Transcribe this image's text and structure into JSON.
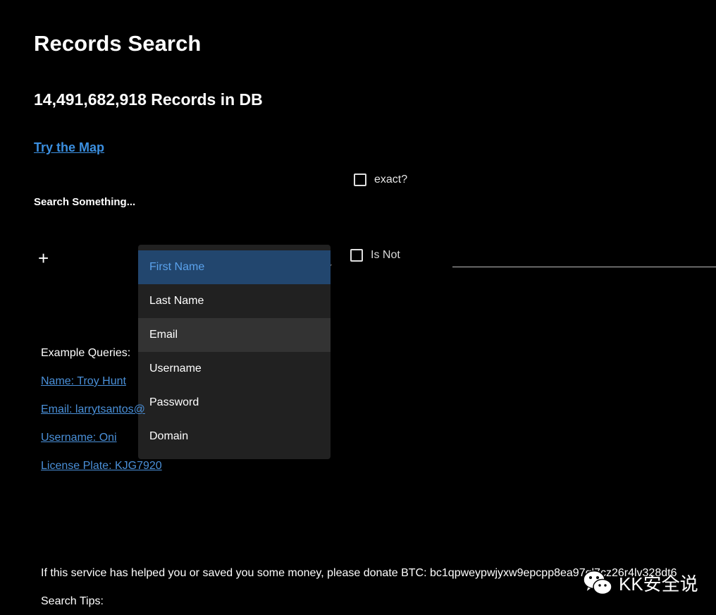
{
  "page": {
    "title": "Records Search",
    "record_count": "14,491,682,918 Records in DB",
    "map_link": "Try the Map"
  },
  "search": {
    "exact_label": "exact?",
    "exact_checked": false,
    "prompt": "Search Something...",
    "add_symbol": "+",
    "is_not_label": "Is Not",
    "is_not_checked": false,
    "field_options": [
      "First Name",
      "Last Name",
      "Email",
      "Username",
      "Password",
      "Domain"
    ],
    "selected_option": "First Name",
    "hovered_option": "Email"
  },
  "examples": {
    "label": "Example Queries:",
    "links": [
      "Name: Troy Hunt",
      "Email: larrytsantos@",
      "Username: Oni",
      "License Plate: KJG7920"
    ]
  },
  "footer": {
    "donate": "If this service has helped you or saved you some money, please donate BTC: bc1qpweypwjyxw9epcpp8ea97ql7cz26r4lv328dt6",
    "tips": "Search Tips:"
  },
  "watermark": {
    "icon": "wechat-icon",
    "text": "KK安全说"
  },
  "colors": {
    "background": "#000000",
    "link": "#4a90d9",
    "menu_bg": "#212121",
    "menu_selected_bg": "#22466e",
    "menu_selected_text": "#5aa2ec"
  }
}
